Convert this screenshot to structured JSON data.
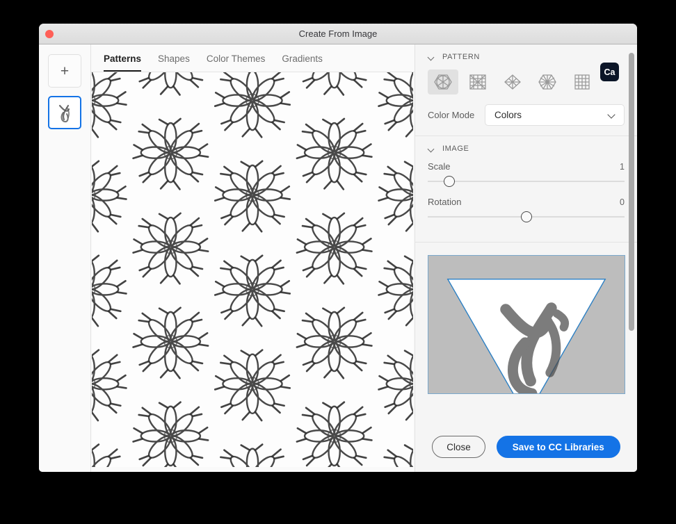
{
  "window": {
    "title": "Create From Image",
    "close_button": "close"
  },
  "rail": {
    "add_label": "+",
    "items": [
      {
        "name": "add-tile",
        "label": "+"
      },
      {
        "name": "source-image-tile",
        "label": "",
        "selected": true
      }
    ]
  },
  "tabs": [
    {
      "label": "Patterns",
      "active": true
    },
    {
      "label": "Shapes",
      "active": false
    },
    {
      "label": "Color Themes",
      "active": false
    },
    {
      "label": "Gradients",
      "active": false
    }
  ],
  "badge": {
    "label": "Ca"
  },
  "panel": {
    "pattern": {
      "section_title": "PATTERN",
      "types": [
        {
          "name": "hexagon-pattern",
          "selected": true
        },
        {
          "name": "square-rays-pattern",
          "selected": false
        },
        {
          "name": "diamond-pattern",
          "selected": false
        },
        {
          "name": "hex-star-pattern",
          "selected": false
        },
        {
          "name": "grid-pattern",
          "selected": false
        }
      ],
      "color_mode_label": "Color Mode",
      "color_mode_value": "Colors",
      "color_mode_options": [
        "Colors"
      ]
    },
    "image": {
      "section_title": "IMAGE",
      "scale_label": "Scale",
      "scale_value": "1",
      "scale_percent": 11,
      "rotation_label": "Rotation",
      "rotation_value": "0",
      "rotation_percent": 50
    }
  },
  "footer": {
    "close_label": "Close",
    "save_label": "Save to CC Libraries"
  },
  "colors": {
    "accent": "#1473e6",
    "badge_bg": "#0b1527",
    "panel_bg": "#f5f5f5",
    "preview_bg": "#bdbdbd",
    "preview_border": "#7aa8cc",
    "traffic_close": "#ff5f57"
  }
}
